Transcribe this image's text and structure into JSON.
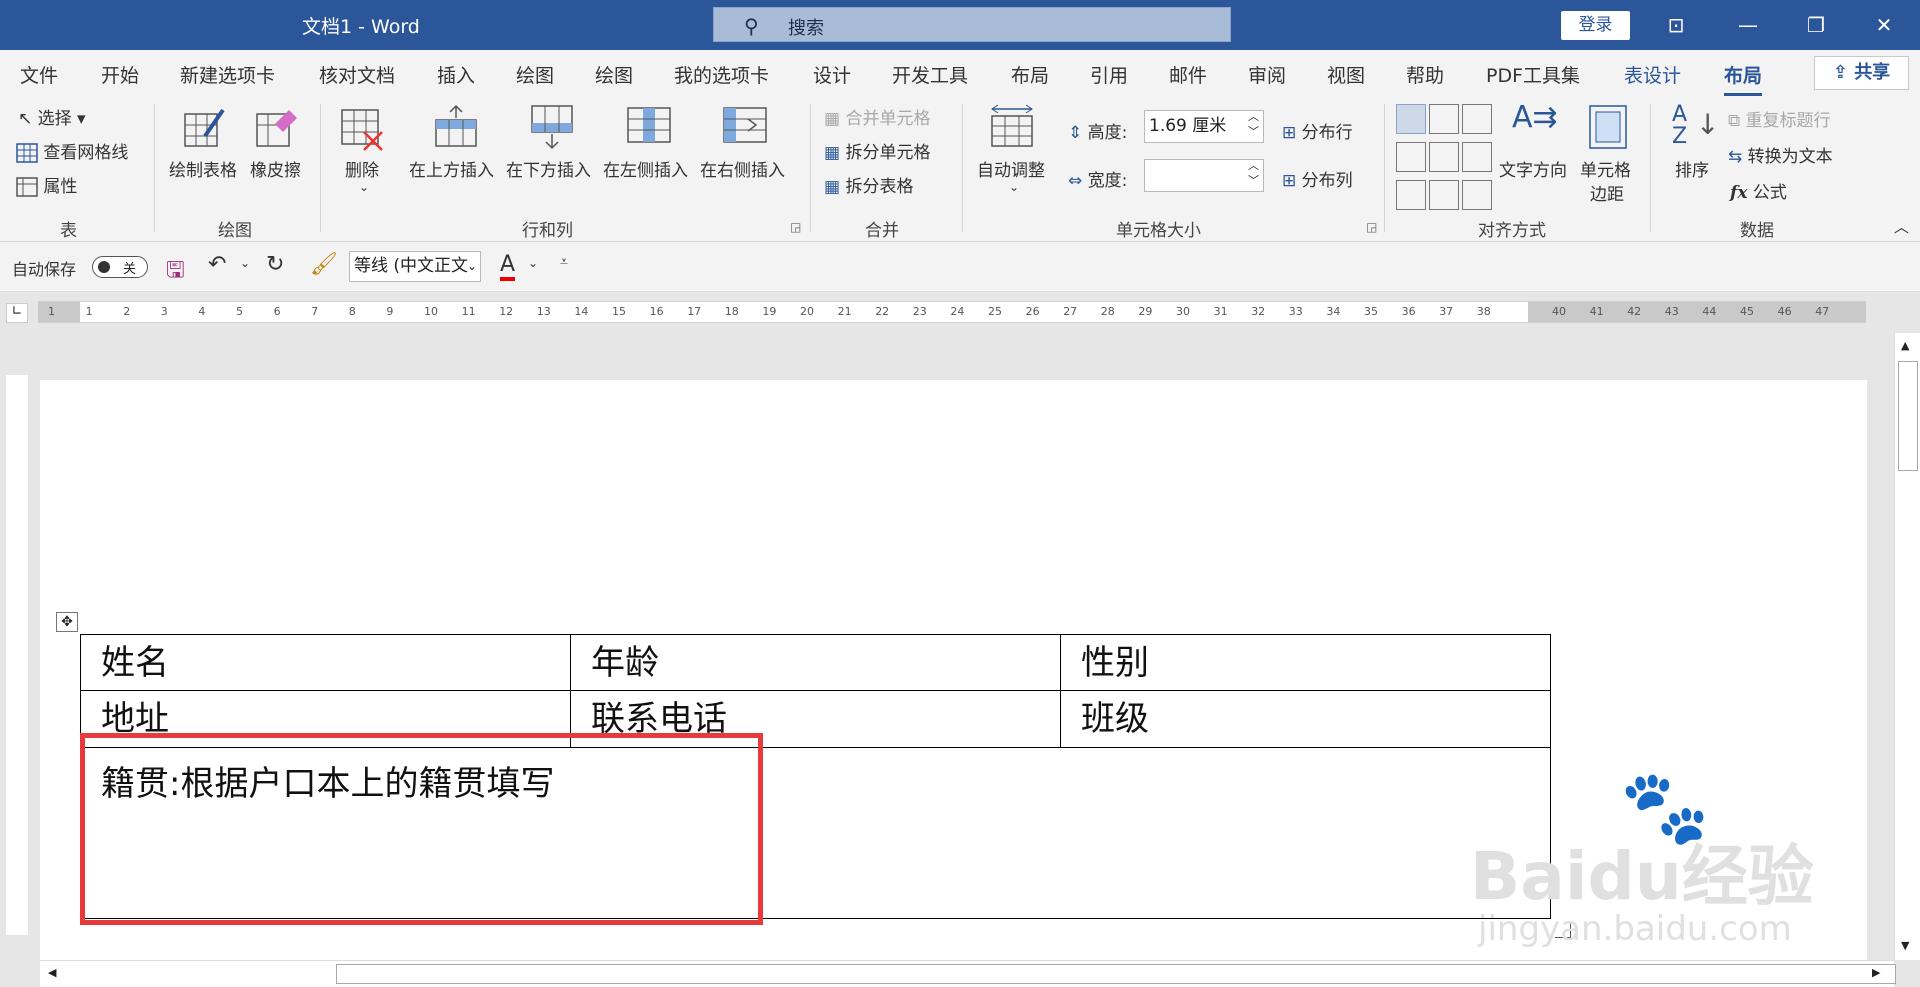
{
  "window": {
    "title": "文档1 - Word",
    "search_placeholder": "搜索",
    "login": "登录"
  },
  "tabs": [
    "文件",
    "开始",
    "新建选项卡",
    "核对文档",
    "插入",
    "绘图",
    "绘图",
    "我的选项卡",
    "设计",
    "开发工具",
    "布局",
    "引用",
    "邮件",
    "审阅",
    "视图",
    "帮助",
    "PDF工具集",
    "表设计",
    "布局"
  ],
  "share": "共享",
  "ribbon": {
    "table": {
      "select": "选择",
      "gridlines": "查看网格线",
      "properties": "属性",
      "label": "表"
    },
    "draw": {
      "draw_table": "绘制表格",
      "eraser": "橡皮擦",
      "label": "绘图"
    },
    "rows_cols": {
      "delete": "删除",
      "insert_above": "在上方插入",
      "insert_below": "在下方插入",
      "insert_left": "在左侧插入",
      "insert_right": "在右侧插入",
      "label": "行和列"
    },
    "merge": {
      "merge_cells": "合并单元格",
      "split_cells": "拆分单元格",
      "split_table": "拆分表格",
      "label": "合并"
    },
    "cell_size": {
      "autofit": "自动调整",
      "height_label": "高度:",
      "height_value": "1.69 厘米",
      "width_label": "宽度:",
      "width_value": "",
      "distribute_rows": "分布行",
      "distribute_cols": "分布列",
      "label": "单元格大小"
    },
    "alignment": {
      "text_direction": "文字方向",
      "cell_margins_1": "单元格",
      "cell_margins_2": "边距",
      "label": "对齐方式"
    },
    "data": {
      "sort": "排序",
      "repeat_header": "重复标题行",
      "convert_text": "转换为文本",
      "formula": "公式",
      "label": "数据"
    }
  },
  "qat": {
    "autosave": "自动保存",
    "toggle": "关",
    "font": "等线 (中文正文"
  },
  "ruler_numbers": [
    "1",
    "1",
    "2",
    "3",
    "4",
    "5",
    "6",
    "7",
    "8",
    "9",
    "10",
    "11",
    "12",
    "13",
    "14",
    "15",
    "16",
    "17",
    "18",
    "19",
    "20",
    "21",
    "22",
    "23",
    "24",
    "25",
    "26",
    "27",
    "28",
    "29",
    "30",
    "31",
    "32",
    "33",
    "34",
    "35",
    "36",
    "37",
    "38",
    "40",
    "41",
    "42",
    "43",
    "44",
    "45",
    "46",
    "47"
  ],
  "table": {
    "row1": [
      "姓名",
      "年龄",
      "性别"
    ],
    "row2": [
      "地址",
      "联系电话",
      "班级"
    ],
    "row3": "籍贯:根据户口本上的籍贯填写"
  },
  "watermark": {
    "brand": "Baidu经验",
    "url": "jingyan.baidu.com"
  },
  "colors": {
    "brand": "#2b579a",
    "highlight": "#e83a3a"
  }
}
